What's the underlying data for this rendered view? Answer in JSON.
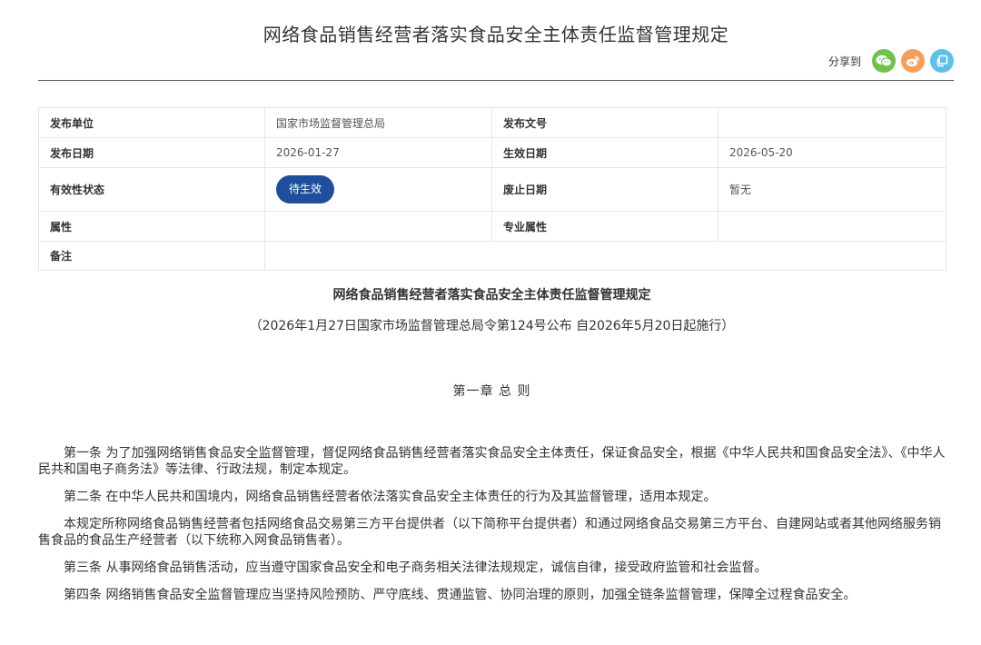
{
  "header": {
    "title": "网络食品销售经营者落实食品安全主体责任监督管理规定",
    "share_label": "分享到",
    "share_icons": [
      {
        "name": "wechat-icon",
        "color": "#6cc34a"
      },
      {
        "name": "weibo-icon",
        "color": "#f5a05a"
      },
      {
        "name": "copy-icon",
        "color": "#5cc1e8"
      }
    ]
  },
  "meta": {
    "publisher_label": "发布单位",
    "publisher_value": "国家市场监督管理总局",
    "doc_no_label": "发布文号",
    "doc_no_value": "",
    "publish_date_label": "发布日期",
    "publish_date_value": "2026-01-27",
    "effective_date_label": "生效日期",
    "effective_date_value": "2026-05-20",
    "validity_label": "有效性状态",
    "validity_value": "待生效",
    "repeal_date_label": "废止日期",
    "repeal_date_value": "暂无",
    "attribute_label": "属性",
    "attribute_value": "",
    "professional_attribute_label": "专业属性",
    "professional_attribute_value": "",
    "remarks_label": "备注",
    "remarks_value": ""
  },
  "document": {
    "heading": "网络食品销售经营者落实食品安全主体责任监督管理规定",
    "subheading": "（2026年1月27日国家市场监督管理总局令第124号公布 自2026年5月20日起施行）",
    "chapter": "第一章  总  则",
    "paragraphs": [
      "第一条  为了加强网络销售食品安全监督管理，督促网络食品销售经营者落实食品安全主体责任，保证食品安全，根据《中华人民共和国食品安全法》、《中华人民共和国电子商务法》等法律、行政法规，制定本规定。",
      "第二条  在中华人民共和国境内，网络食品销售经营者依法落实食品安全主体责任的行为及其监督管理，适用本规定。",
      "本规定所称网络食品销售经营者包括网络食品交易第三方平台提供者（以下简称平台提供者）和通过网络食品交易第三方平台、自建网站或者其他网络服务销售食品的食品生产经营者（以下统称入网食品销售者）。",
      "第三条  从事网络食品销售活动，应当遵守国家食品安全和电子商务相关法律法规规定，诚信自律，接受政府监管和社会监督。",
      "第四条  网络销售食品安全监督管理应当坚持风险预防、严守底线、贯通监管、协同治理的原则，加强全链条监督管理，保障全过程食品安全。"
    ]
  }
}
